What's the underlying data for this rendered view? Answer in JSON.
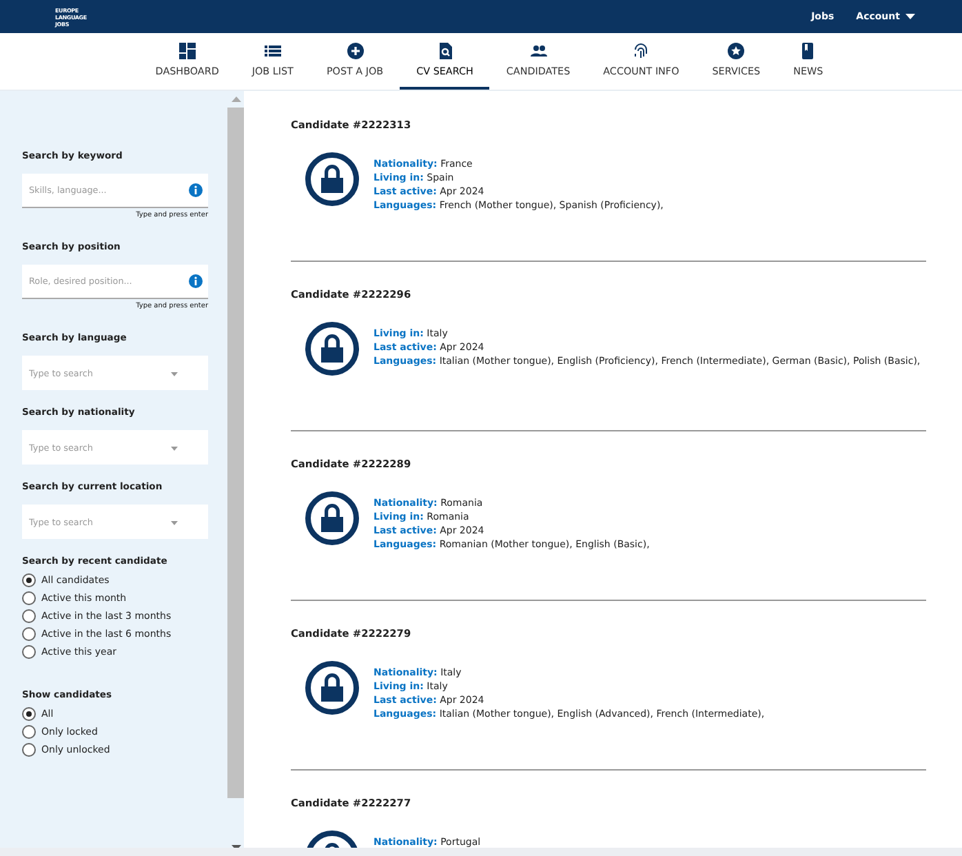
{
  "logo": {
    "lines": [
      "EUROPE",
      "LANGUAGE",
      "JOBS"
    ]
  },
  "top_links": [
    {
      "label": "Jobs",
      "kind": "link"
    },
    {
      "label": "Account",
      "kind": "dropdown"
    }
  ],
  "nav": [
    {
      "label": "DASHBOARD",
      "selected": false
    },
    {
      "label": "JOB LIST",
      "selected": false
    },
    {
      "label": "POST A JOB",
      "selected": false
    },
    {
      "label": "CV SEARCH",
      "selected": true
    },
    {
      "label": "CANDIDATES",
      "selected": false
    },
    {
      "label": "ACCOUNT INFO",
      "selected": false
    },
    {
      "label": "SERVICES",
      "selected": false
    },
    {
      "label": "NEWS",
      "selected": false
    }
  ],
  "filters": [
    {
      "kind": "text",
      "label": "Search by keyword",
      "placeholder": "Skills, language...",
      "hint": "Type and press enter"
    },
    {
      "kind": "text",
      "label": "Search by position",
      "placeholder": "Role, desired position...",
      "hint": "Type and press enter"
    },
    {
      "kind": "select",
      "label": "Search by language",
      "placeholder": "Type to search"
    },
    {
      "kind": "select",
      "label": "Search by nationality",
      "placeholder": "Type to search"
    },
    {
      "kind": "select",
      "label": "Search by current location",
      "placeholder": "Type to search"
    },
    {
      "kind": "radio",
      "label": "Search by recent candidate",
      "options": [
        {
          "label": "All candidates",
          "selected": true
        },
        {
          "label": "Active this month",
          "selected": false
        },
        {
          "label": "Active in the last 3 months",
          "selected": false
        },
        {
          "label": "Active in the last 6 months",
          "selected": false
        },
        {
          "label": "Active this year",
          "selected": false
        }
      ]
    },
    {
      "kind": "radio",
      "label": "Show candidates",
      "options": [
        {
          "label": "All",
          "selected": true
        },
        {
          "label": "Only locked",
          "selected": false
        },
        {
          "label": "Only unlocked",
          "selected": false
        }
      ]
    }
  ],
  "candidates": [
    {
      "title": "Candidate #2222313",
      "locked": true,
      "details": [
        {
          "label": "Nationality:",
          "value": "France"
        },
        {
          "label": "Living in:",
          "value": "Spain"
        },
        {
          "label": "Last active:",
          "value": "Apr 2024"
        },
        {
          "label": "Languages:",
          "value": "French (Mother tongue), Spanish (Proficiency),"
        }
      ]
    },
    {
      "title": "Candidate #2222296",
      "locked": true,
      "details": [
        {
          "label": "Living in:",
          "value": "Italy"
        },
        {
          "label": "Last active:",
          "value": "Apr 2024"
        },
        {
          "label": "Languages:",
          "value": "Italian (Mother tongue), English (Proficiency), French (Intermediate), German (Basic), Polish (Basic),"
        }
      ]
    },
    {
      "title": "Candidate #2222289",
      "locked": true,
      "details": [
        {
          "label": "Nationality:",
          "value": "Romania"
        },
        {
          "label": "Living in:",
          "value": "Romania"
        },
        {
          "label": "Last active:",
          "value": "Apr 2024"
        },
        {
          "label": "Languages:",
          "value": "Romanian (Mother tongue), English (Basic),"
        }
      ]
    },
    {
      "title": "Candidate #2222279",
      "locked": true,
      "details": [
        {
          "label": "Nationality:",
          "value": "Italy"
        },
        {
          "label": "Living in:",
          "value": "Italy"
        },
        {
          "label": "Last active:",
          "value": "Apr 2024"
        },
        {
          "label": "Languages:",
          "value": "Italian (Mother tongue), English (Advanced), French (Intermediate),"
        }
      ]
    },
    {
      "title": "Candidate #2222277",
      "locked": true,
      "details": [
        {
          "label": "Nationality:",
          "value": "Portugal"
        }
      ]
    }
  ]
}
